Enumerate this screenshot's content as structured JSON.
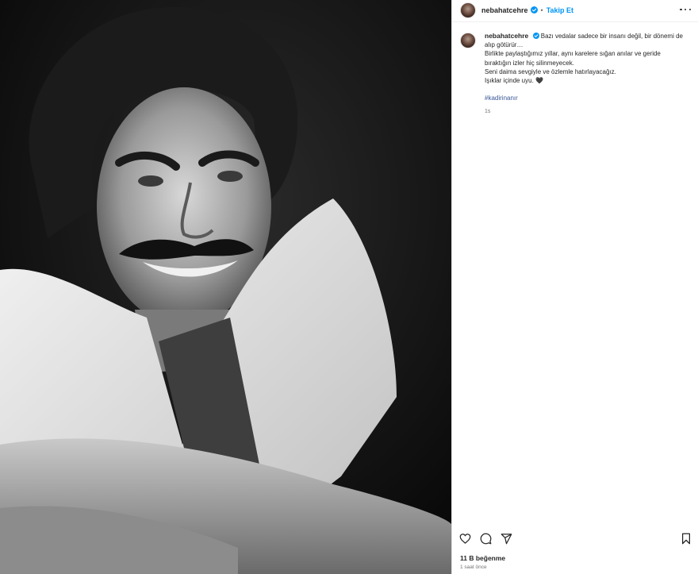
{
  "post": {
    "username": "nebahatcehre",
    "follow_label": "Takip Et",
    "separator": "•",
    "caption_lines": [
      "Bazı vedalar sadece bir insanı değil, bir dönemi de alıp götürür…",
      "Birlikte paylaştığımız yıllar, aynı karelere sığan anılar ve geride bıraktığın izler hiç silinmeyecek.",
      "Seni daima sevgiyle ve özlemle hatırlayacağız.",
      "Işıklar içinde uyu. 🖤"
    ],
    "hashtag": "#kadirinanır",
    "caption_time": "1s",
    "likes": "11 B beğenme",
    "posted_ago": "1 saat önce"
  },
  "colors": {
    "accent": "#0095f6",
    "verified": "#0095f6",
    "text": "#262626",
    "muted": "#737373"
  },
  "icons": [
    "more-options-icon",
    "verified-badge-icon",
    "heart-icon",
    "comment-icon",
    "share-icon",
    "bookmark-icon"
  ]
}
